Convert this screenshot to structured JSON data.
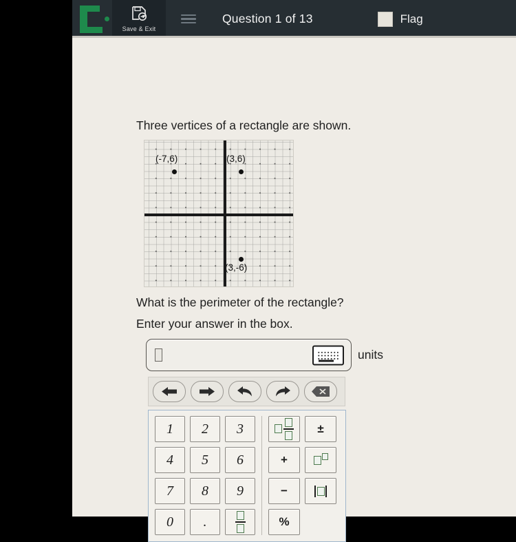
{
  "header": {
    "logo_name": "e-logo",
    "save_exit_label": "Save & Exit",
    "save_exit_icon": "save-floppy-icon",
    "menu_icon": "hamburger-menu-icon",
    "question_title": "Question 1 of 13",
    "flag_label": "Flag",
    "flag_checked": false,
    "background_color": "#262e33"
  },
  "question": {
    "prompt": "Three vertices of a rectangle are shown.",
    "ask": "What is the perimeter of the rectangle?",
    "instruction": "Enter your answer in the box."
  },
  "chart_data": {
    "type": "scatter",
    "title": "",
    "xlabel": "",
    "ylabel": "",
    "xlim": [
      -11,
      9
    ],
    "ylim": [
      -10,
      10
    ],
    "grid": true,
    "legend": "none",
    "points": [
      {
        "label": "(-7,6)",
        "x": -7,
        "y": 6
      },
      {
        "label": "(3,6)",
        "x": 3,
        "y": 6
      },
      {
        "label": "(3,-6)",
        "x": 3,
        "y": -6
      }
    ]
  },
  "answer": {
    "value": "",
    "caret_placeholder": "",
    "keyboard_icon": "keyboard-icon",
    "units_label": "units"
  },
  "calculator": {
    "toolbar": [
      {
        "name": "move-left-button",
        "icon": "arrow-left-icon"
      },
      {
        "name": "move-right-button",
        "icon": "arrow-right-icon"
      },
      {
        "name": "undo-button",
        "icon": "undo-arrow-icon"
      },
      {
        "name": "redo-button",
        "icon": "redo-arrow-icon"
      },
      {
        "name": "delete-button",
        "icon": "backspace-x-icon"
      }
    ],
    "digits": [
      "1",
      "2",
      "3",
      "4",
      "5",
      "6",
      "7",
      "8",
      "9",
      "0",
      "."
    ],
    "fraction_label": "□/□",
    "operators": [
      {
        "name": "mixed-number-key",
        "label": "□ □/□"
      },
      {
        "name": "plus-minus-key",
        "label": "±"
      },
      {
        "name": "plus-key",
        "label": "+"
      },
      {
        "name": "exponent-key",
        "label": "□^□"
      },
      {
        "name": "minus-key",
        "label": "−"
      },
      {
        "name": "absolute-value-key",
        "label": "|□|"
      },
      {
        "name": "percent-key",
        "label": "%"
      }
    ],
    "accent_color": "#4e7a4e",
    "border_color": "#9fb6cc"
  }
}
